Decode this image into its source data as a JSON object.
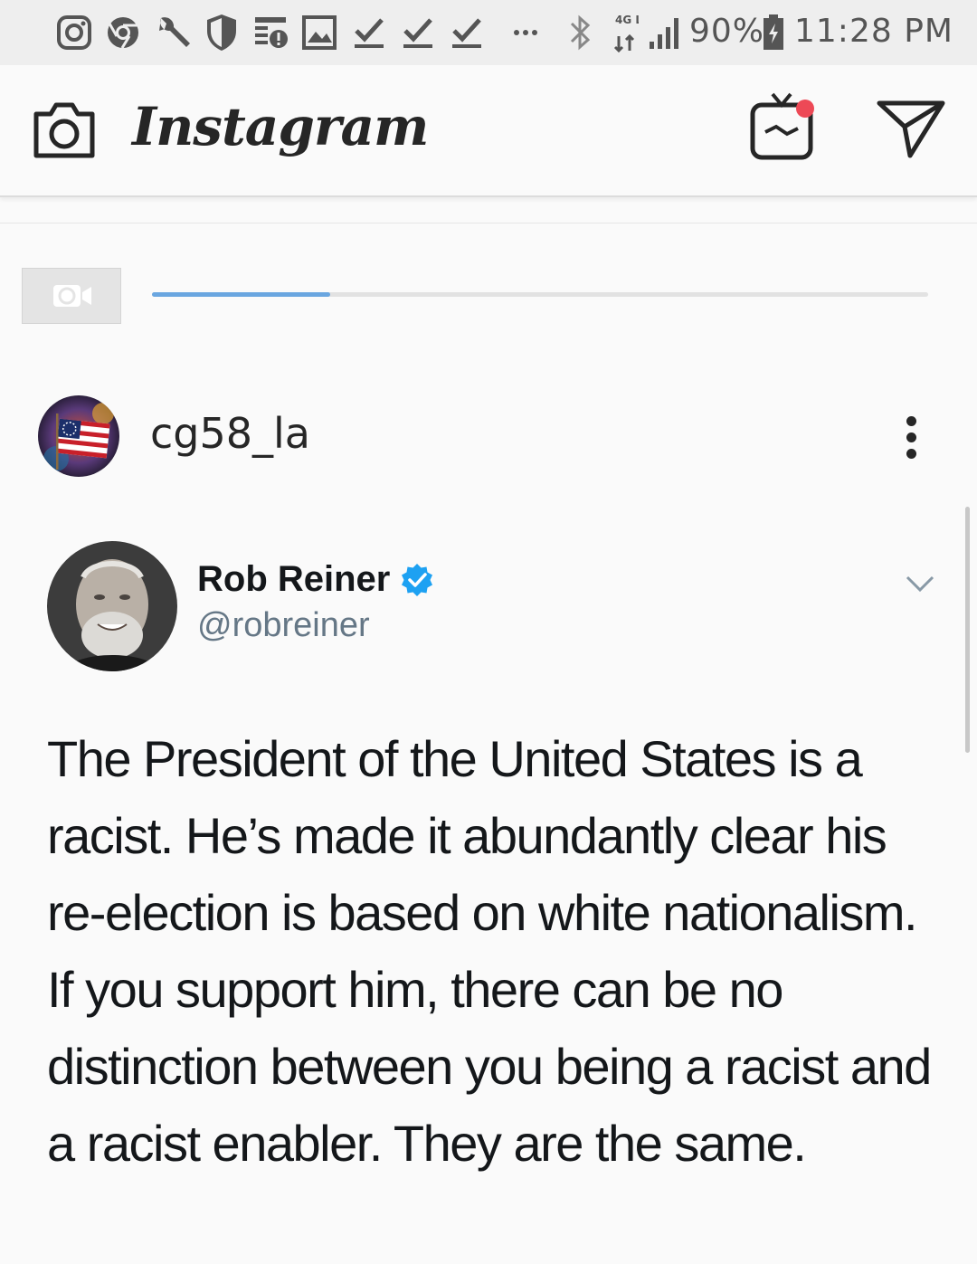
{
  "status_bar": {
    "icons": [
      "instagram-icon",
      "chrome-icon",
      "wrench-icon",
      "shield-icon",
      "news-alert-icon",
      "image-icon",
      "download-done-icon",
      "download-done-icon",
      "download-done-icon",
      "more-icon",
      "bluetooth-icon",
      "lte-icon",
      "signal-icon"
    ],
    "network": "4G LTE",
    "battery": "90%",
    "time": "11:28 PM"
  },
  "header": {
    "logo": "Instagram",
    "igtv_has_notification": true
  },
  "upload": {
    "progress": 0.23
  },
  "post": {
    "username": "cg58_la",
    "tweet": {
      "name": "Rob Reiner",
      "handle": "@robreiner",
      "verified": true,
      "text": "The President of the United States is a racist. He’s made it abundantly clear his re-election is based on white nationalism. If you support him, there can be no distinction between you being a racist and a racist enabler. They are the same."
    }
  },
  "colors": {
    "accent_blue": "#1da1f2",
    "progress_blue": "#6aa6e0",
    "notification_red": "#ed4956"
  }
}
